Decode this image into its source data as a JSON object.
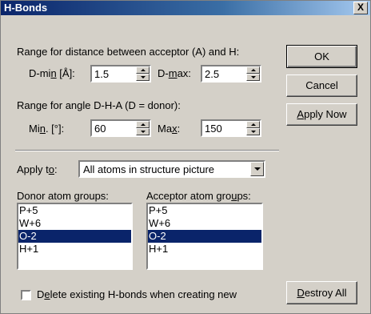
{
  "window": {
    "title": "H-Bonds",
    "close_glyph": "X"
  },
  "distance": {
    "heading": "Range for distance between acceptor (A) and H:",
    "min_label_pre": "D-mi",
    "min_label_u": "n",
    "min_label_post": " [Å]:",
    "min_value": "1.5",
    "max_label_pre": "D-",
    "max_label_u": "m",
    "max_label_post": "ax:",
    "max_value": "2.5"
  },
  "angle": {
    "heading": "Range for angle D-H-A (D = donor):",
    "min_label_pre": "Mi",
    "min_label_u": "n",
    "min_label_post": ". [°]:",
    "min_value": "60",
    "max_label_pre": "Ma",
    "max_label_u": "x",
    "max_label_post": ":",
    "max_value": "150"
  },
  "apply_to": {
    "label_pre": "Apply t",
    "label_u": "o",
    "label_post": ":",
    "selected": "All atoms in structure picture"
  },
  "donor": {
    "label_pre": "Donor atom ",
    "label_u": "g",
    "label_post": "roups:",
    "items": [
      "P+5",
      "W+6",
      "O-2",
      "H+1"
    ],
    "selected_index": 2
  },
  "acceptor": {
    "label_pre": "Acceptor atom gro",
    "label_u": "u",
    "label_post": "ps:",
    "items": [
      "P+5",
      "W+6",
      "O-2",
      "H+1"
    ],
    "selected_index": 2
  },
  "delete_existing": {
    "label_pre": "D",
    "label_u": "e",
    "label_post": "lete existing H-bonds when creating new",
    "checked": false
  },
  "buttons": {
    "ok": "OK",
    "cancel": "Cancel",
    "apply_now_u": "A",
    "apply_now_rest": "pply Now",
    "destroy_u": "D",
    "destroy_rest": "estroy All"
  }
}
